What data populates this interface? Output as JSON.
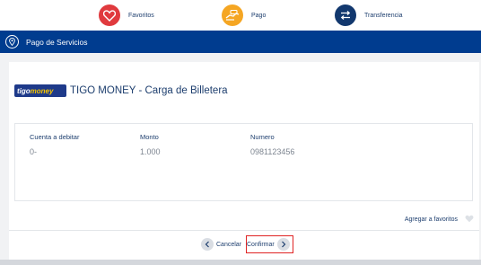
{
  "quick_actions": {
    "favorites_label": "Favoritos",
    "payment_label": "Pago",
    "transfer_label": "Transferencia"
  },
  "section": {
    "title": "Pago de Servicios"
  },
  "provider": {
    "logo_text_a": "tigo",
    "logo_text_b": "money",
    "name": "TIGO MONEY - Carga de Billetera"
  },
  "detail": {
    "account_label": "Cuenta a debitar",
    "account_value": "0-",
    "amount_label": "Monto",
    "amount_value": "1.000",
    "number_label": "Numero",
    "number_value": "0981123456"
  },
  "actions": {
    "add_favorite": "Agregar a favoritos",
    "cancel": "Cancelar",
    "confirm": "Confirmar"
  },
  "colors": {
    "brand_blue": "#003c8f",
    "favorites": "#e03a3e",
    "payment": "#f5a623",
    "transfer": "#12386e",
    "highlight_red": "#e02424"
  }
}
